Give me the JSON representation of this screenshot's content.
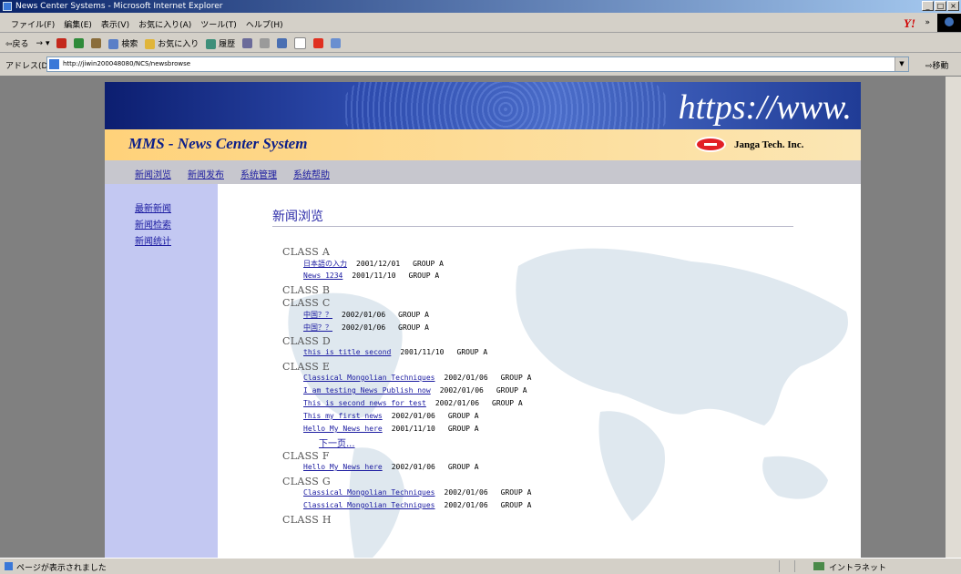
{
  "window": {
    "title": "News Center Systems - Microsoft Internet Explorer",
    "buttons": [
      "_",
      "□",
      "×"
    ]
  },
  "menubar": {
    "items": [
      "ファイル(F)",
      "編集(E)",
      "表示(V)",
      "お気に入り(A)",
      "ツール(T)",
      "ヘルプ(H)"
    ],
    "brand": "Y!",
    "chevron": "»"
  },
  "toolbar": {
    "back_label": "⇦戻る",
    "search_label": "検索",
    "favorites_label": "お気に入り",
    "history_label": "履歴"
  },
  "addressbar": {
    "label": "アドレス(D)",
    "url": "http://jiwin200048080/NCS/newsbrowse",
    "go_label": "移動"
  },
  "page": {
    "banner_text": "https://www.",
    "system_title": "MMS - News Center System",
    "company": "Janga Tech. Inc.",
    "nav": [
      "新闻浏览",
      "新闻发布",
      "系统管理",
      "系统帮助"
    ],
    "sidebar": [
      "最新新闻",
      "新闻检索",
      "新闻统计"
    ],
    "heading": "新闻浏览",
    "more_label": "下一页..."
  },
  "classes": [
    {
      "name": "CLASS A",
      "items": [
        {
          "title": "日本語の入力",
          "date": "2001/12/01",
          "group": "GROUP A"
        },
        {
          "title": "News 1234",
          "date": "2001/11/10",
          "group": "GROUP A"
        }
      ]
    },
    {
      "name": "CLASS B",
      "items": []
    },
    {
      "name": "CLASS C",
      "items": [
        {
          "title": "中国？？",
          "date": "2002/01/06",
          "group": "GROUP A"
        },
        {
          "title": "中国？？",
          "date": "2002/01/06",
          "group": "GROUP A"
        }
      ]
    },
    {
      "name": "CLASS D",
      "items": [
        {
          "title": "this is title second",
          "date": "2001/11/10",
          "group": "GROUP A"
        }
      ]
    },
    {
      "name": "CLASS E",
      "more": true,
      "items": [
        {
          "title": "Classical Mongolian Techniques",
          "date": "2002/01/06",
          "group": "GROUP A"
        },
        {
          "title": "I am testing News Publish now",
          "date": "2002/01/06",
          "group": "GROUP A"
        },
        {
          "title": "This is second news for test",
          "date": "2002/01/06",
          "group": "GROUP A"
        },
        {
          "title": "This my first news",
          "date": "2002/01/06",
          "group": "GROUP A"
        },
        {
          "title": "Hello My News here",
          "date": "2001/11/10",
          "group": "GROUP A"
        }
      ]
    },
    {
      "name": "CLASS F",
      "items": [
        {
          "title": "Hello My News here",
          "date": "2002/01/06",
          "group": "GROUP A"
        }
      ]
    },
    {
      "name": "CLASS G",
      "items": [
        {
          "title": "Classical Mongolian Techniques",
          "date": "2002/01/06",
          "group": "GROUP A"
        },
        {
          "title": "Classical Mongolian Techniques",
          "date": "2002/01/06",
          "group": "GROUP A"
        }
      ]
    },
    {
      "name": "CLASS H",
      "items": []
    }
  ],
  "statusbar": {
    "message": "ページが表示されました",
    "zone": "イントラネット"
  }
}
